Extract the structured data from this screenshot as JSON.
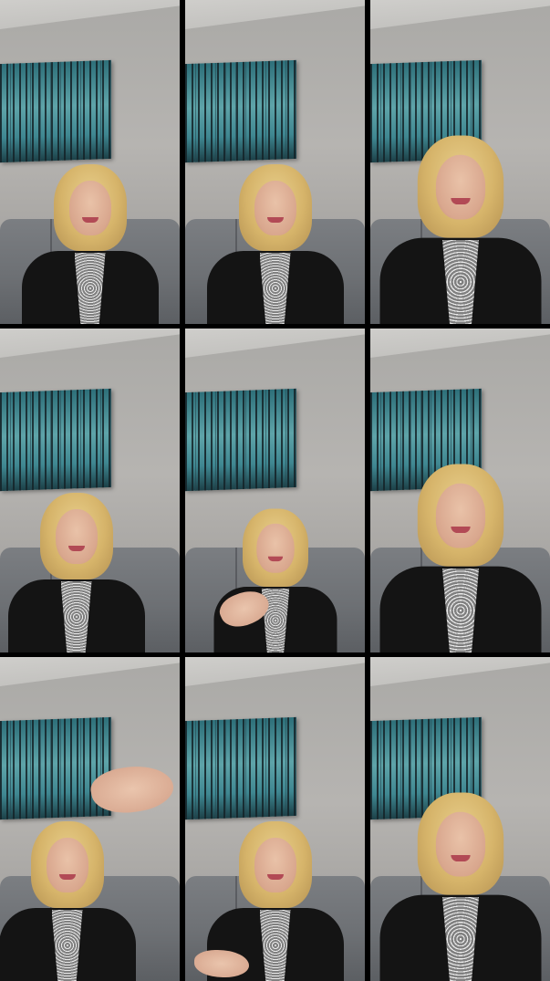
{
  "grid": {
    "rows": 3,
    "columns": 3,
    "frames": [
      {
        "id": 1,
        "pose": "smiling",
        "gesture": "none"
      },
      {
        "id": 2,
        "pose": "talking",
        "gesture": "none"
      },
      {
        "id": 3,
        "pose": "smiling-close",
        "gesture": "none"
      },
      {
        "id": 4,
        "pose": "smiling",
        "gesture": "none"
      },
      {
        "id": 5,
        "pose": "talking",
        "gesture": "open-hand-left"
      },
      {
        "id": 6,
        "pose": "smiling-close",
        "gesture": "none"
      },
      {
        "id": 7,
        "pose": "talking",
        "gesture": "pointing-hand-top-right"
      },
      {
        "id": 8,
        "pose": "talking",
        "gesture": "reaching-forward"
      },
      {
        "id": 9,
        "pose": "talking-close",
        "gesture": "none"
      }
    ]
  },
  "colors": {
    "background": "#000000",
    "wall": "#b4b2af",
    "couch": "#6d7074",
    "painting_teal": "#3f8791",
    "hair_blonde": "#d6b46a",
    "top_black": "#141414"
  }
}
